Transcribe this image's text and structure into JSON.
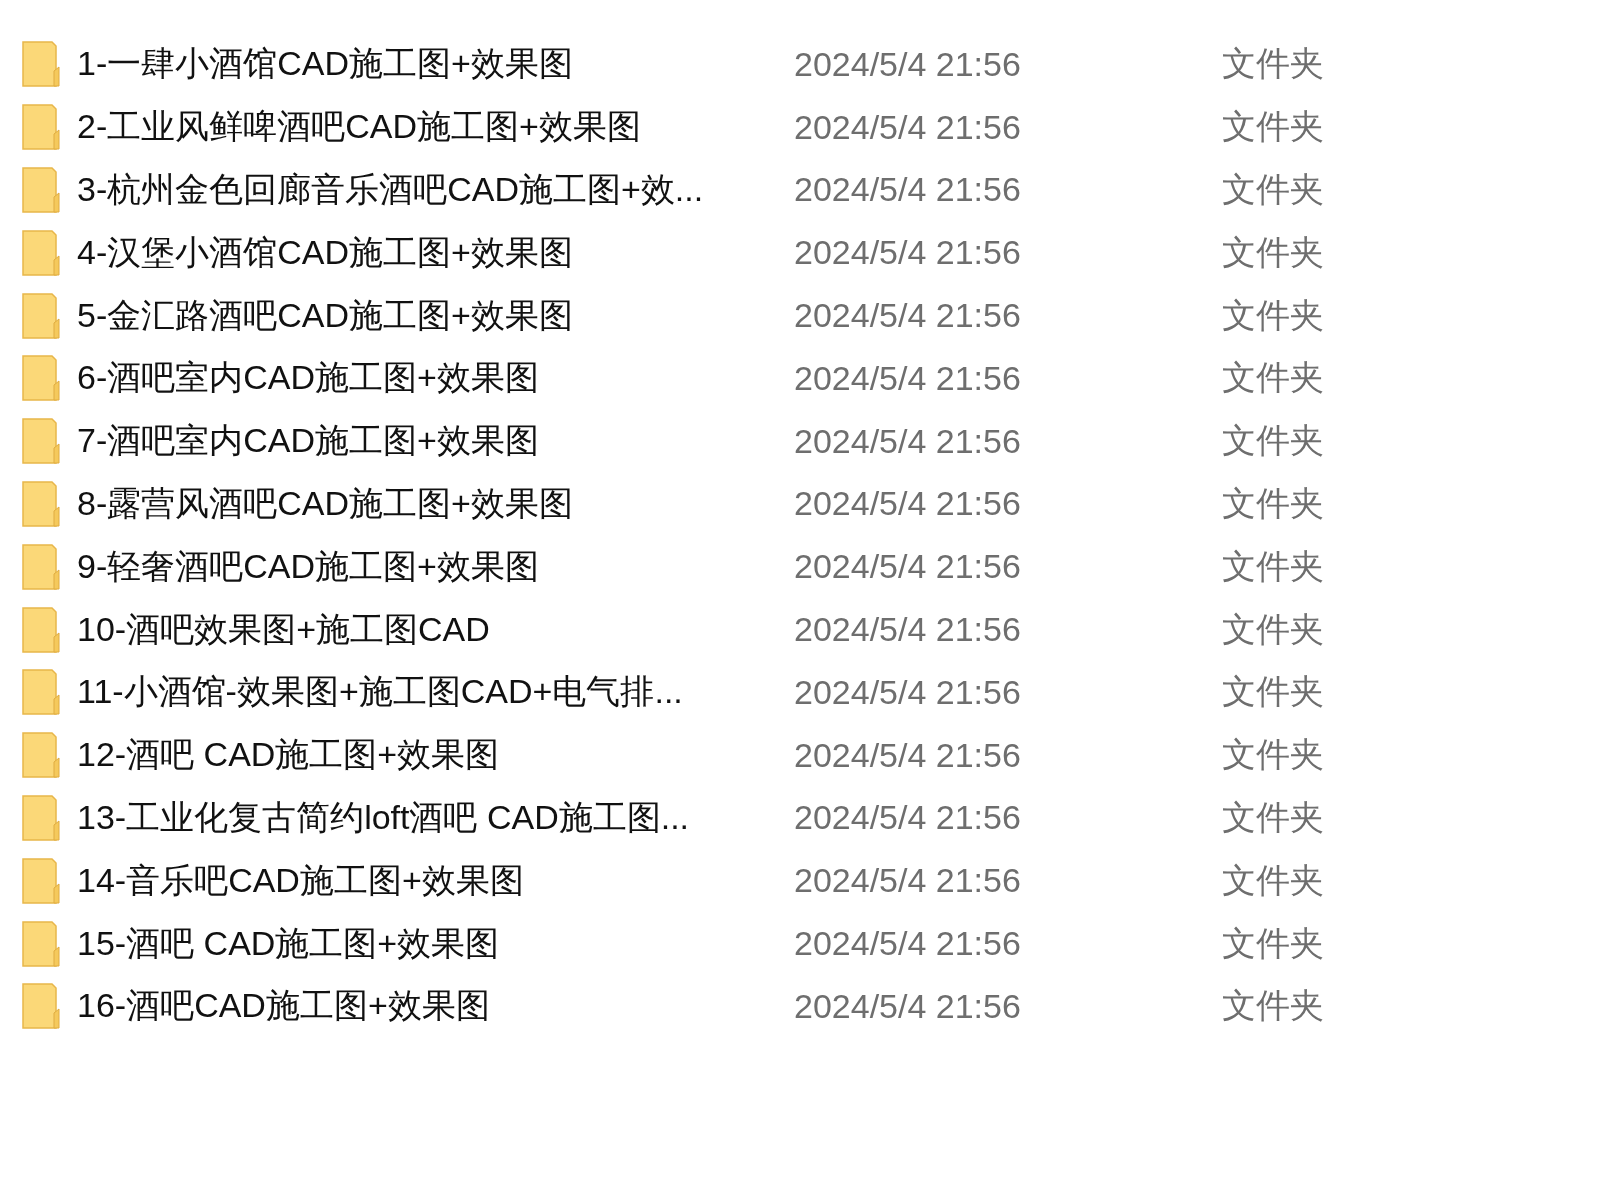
{
  "files": [
    {
      "name": "1-一肆小酒馆CAD施工图+效果图",
      "modified": "2024/5/4 21:56",
      "type": "文件夹"
    },
    {
      "name": "2-工业风鲜啤酒吧CAD施工图+效果图",
      "modified": "2024/5/4 21:56",
      "type": "文件夹"
    },
    {
      "name": "3-杭州金色回廊音乐酒吧CAD施工图+效...",
      "modified": "2024/5/4 21:56",
      "type": "文件夹"
    },
    {
      "name": "4-汉堡小酒馆CAD施工图+效果图",
      "modified": "2024/5/4 21:56",
      "type": "文件夹"
    },
    {
      "name": "5-金汇路酒吧CAD施工图+效果图",
      "modified": "2024/5/4 21:56",
      "type": "文件夹"
    },
    {
      "name": "6-酒吧室内CAD施工图+效果图",
      "modified": "2024/5/4 21:56",
      "type": "文件夹"
    },
    {
      "name": "7-酒吧室内CAD施工图+效果图",
      "modified": "2024/5/4 21:56",
      "type": "文件夹"
    },
    {
      "name": "8-露营风酒吧CAD施工图+效果图",
      "modified": "2024/5/4 21:56",
      "type": "文件夹"
    },
    {
      "name": "9-轻奢酒吧CAD施工图+效果图",
      "modified": "2024/5/4 21:56",
      "type": "文件夹"
    },
    {
      "name": "10-酒吧效果图+施工图CAD",
      "modified": "2024/5/4 21:56",
      "type": "文件夹"
    },
    {
      "name": "11-小酒馆-效果图+施工图CAD+电气排...",
      "modified": "2024/5/4 21:56",
      "type": "文件夹"
    },
    {
      "name": "12-酒吧 CAD施工图+效果图",
      "modified": "2024/5/4 21:56",
      "type": "文件夹"
    },
    {
      "name": "13-工业化复古简约loft酒吧 CAD施工图...",
      "modified": "2024/5/4 21:56",
      "type": "文件夹"
    },
    {
      "name": "14-音乐吧CAD施工图+效果图",
      "modified": "2024/5/4 21:56",
      "type": "文件夹"
    },
    {
      "name": "15-酒吧 CAD施工图+效果图",
      "modified": "2024/5/4 21:56",
      "type": "文件夹"
    },
    {
      "name": "16-酒吧CAD施工图+效果图",
      "modified": "2024/5/4 21:56",
      "type": "文件夹"
    }
  ]
}
